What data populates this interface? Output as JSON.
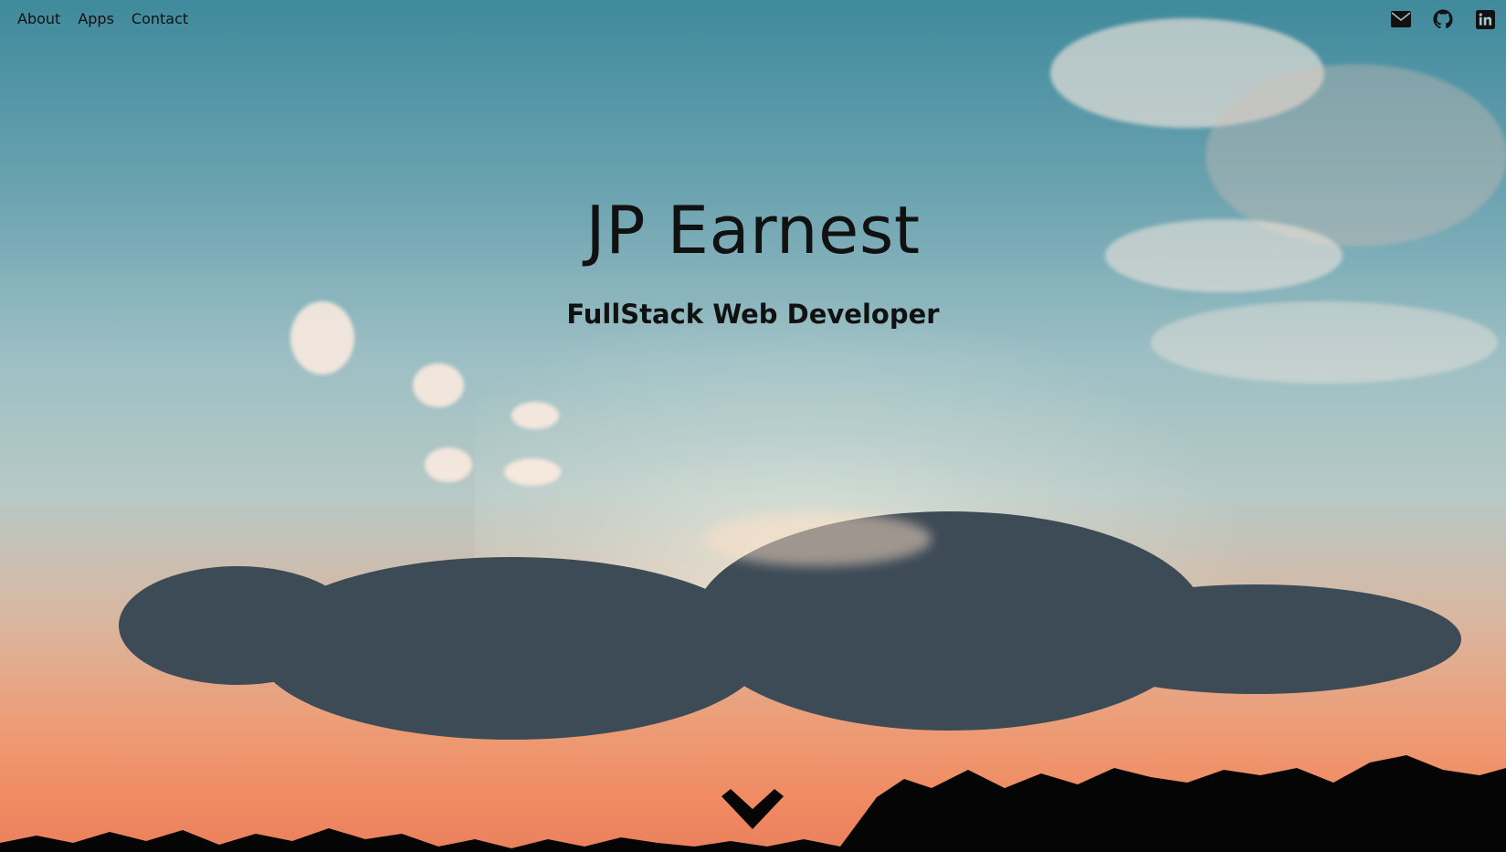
{
  "nav": {
    "links": [
      {
        "label": "About"
      },
      {
        "label": "Apps"
      },
      {
        "label": "Contact"
      }
    ],
    "social_icons": [
      "envelope-icon",
      "github-icon",
      "linkedin-icon"
    ]
  },
  "hero": {
    "name": "JP Earnest",
    "subtitle": "FullStack Web Developer",
    "scroll_icon": "chevron-down-icon"
  },
  "colors": {
    "sky_top": "#3f8a9c",
    "sky_bottom": "#ec9f79",
    "text": "#111111"
  }
}
